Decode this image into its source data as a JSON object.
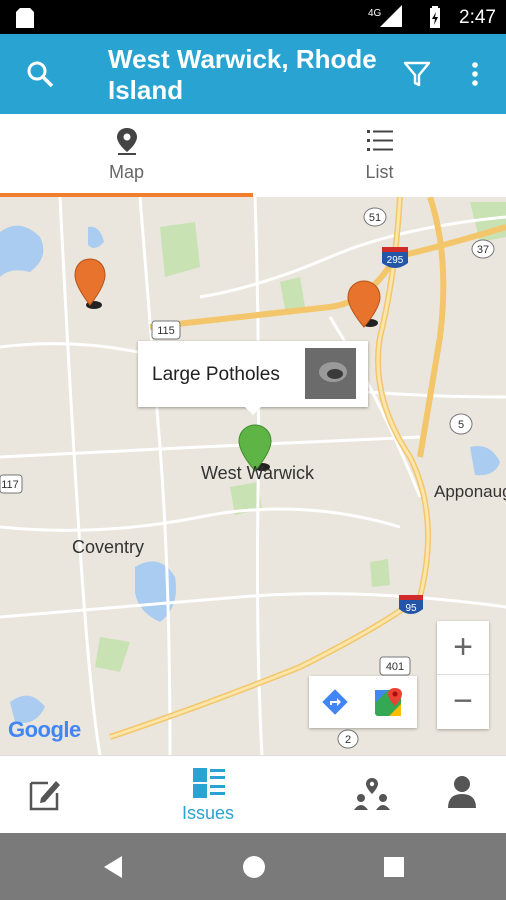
{
  "status_bar": {
    "time": "2:47",
    "network": "4G"
  },
  "app_bar": {
    "title": "West Warwick, Rhode Island"
  },
  "tabs": [
    {
      "label": "Map",
      "icon": "map-pin-icon",
      "selected": true
    },
    {
      "label": "List",
      "icon": "list-icon",
      "selected": false
    }
  ],
  "map": {
    "callout": {
      "title": "Large Potholes"
    },
    "labels": {
      "town_main": "West Warwick",
      "coventry": "Coventry",
      "apponaug": "Apponaug"
    },
    "shields": [
      "51",
      "295",
      "37",
      "115",
      "117",
      "5",
      "95",
      "401",
      "2"
    ],
    "attribution": "Google",
    "zoom_in": "+",
    "zoom_out": "−"
  },
  "bottom_nav": {
    "items": [
      {
        "label": "",
        "icon": "edit-icon"
      },
      {
        "label": "Issues",
        "icon": "issues-icon",
        "selected": true
      },
      {
        "label": "",
        "icon": "community-icon"
      },
      {
        "label": "",
        "icon": "profile-icon"
      }
    ]
  },
  "colors": {
    "accent": "#29a3d1",
    "tab_indicator": "#f08030",
    "marker_orange": "#e8732c",
    "marker_green": "#5fb446"
  }
}
